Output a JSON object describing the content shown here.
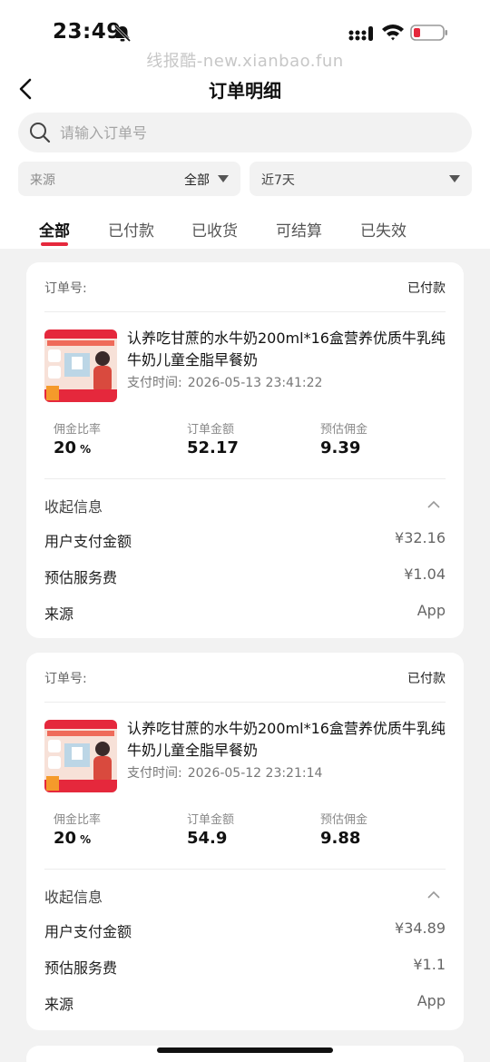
{
  "status_bar": {
    "time": "23:49"
  },
  "watermark": "线报酷-new.xianbao.fun",
  "nav": {
    "title": "订单明细"
  },
  "search": {
    "placeholder": "请输入订单号"
  },
  "filters": {
    "source_label": "来源",
    "source_value": "全部",
    "date_value": "近7天"
  },
  "tabs": [
    "全部",
    "已付款",
    "已收货",
    "可结算",
    "已失效"
  ],
  "active_tab": "全部",
  "colors": {
    "accent": "#e5283c",
    "background": "#f2f2f2"
  },
  "orders": [
    {
      "order_label": "订单号:",
      "status": "已付款",
      "product_title": "认养吃甘蔗的水牛奶200ml*16盒营养优质牛乳纯牛奶儿童全脂早餐奶",
      "pay_time_label": "支付时间:",
      "pay_time": "2026-05-13 23:41:22",
      "metrics": {
        "rate_label": "佣金比率",
        "rate": "20",
        "rate_unit": "%",
        "amount_label": "订单金额",
        "amount": "52.17",
        "commission_label": "预估佣金",
        "commission": "9.39"
      },
      "fold_title": "收起信息",
      "rows": [
        {
          "label": "用户支付金额",
          "value": "¥32.16"
        },
        {
          "label": "预估服务费",
          "value": "¥1.04"
        },
        {
          "label": "来源",
          "value": "App"
        }
      ]
    },
    {
      "order_label": "订单号:",
      "status": "已付款",
      "product_title": "认养吃甘蔗的水牛奶200ml*16盒营养优质牛乳纯牛奶儿童全脂早餐奶",
      "pay_time_label": "支付时间:",
      "pay_time": "2026-05-12 23:21:14",
      "metrics": {
        "rate_label": "佣金比率",
        "rate": "20",
        "rate_unit": "%",
        "amount_label": "订单金额",
        "amount": "54.9",
        "commission_label": "预估佣金",
        "commission": "9.88"
      },
      "fold_title": "收起信息",
      "rows": [
        {
          "label": "用户支付金额",
          "value": "¥34.89"
        },
        {
          "label": "预估服务费",
          "value": "¥1.1"
        },
        {
          "label": "来源",
          "value": "App"
        }
      ]
    }
  ]
}
